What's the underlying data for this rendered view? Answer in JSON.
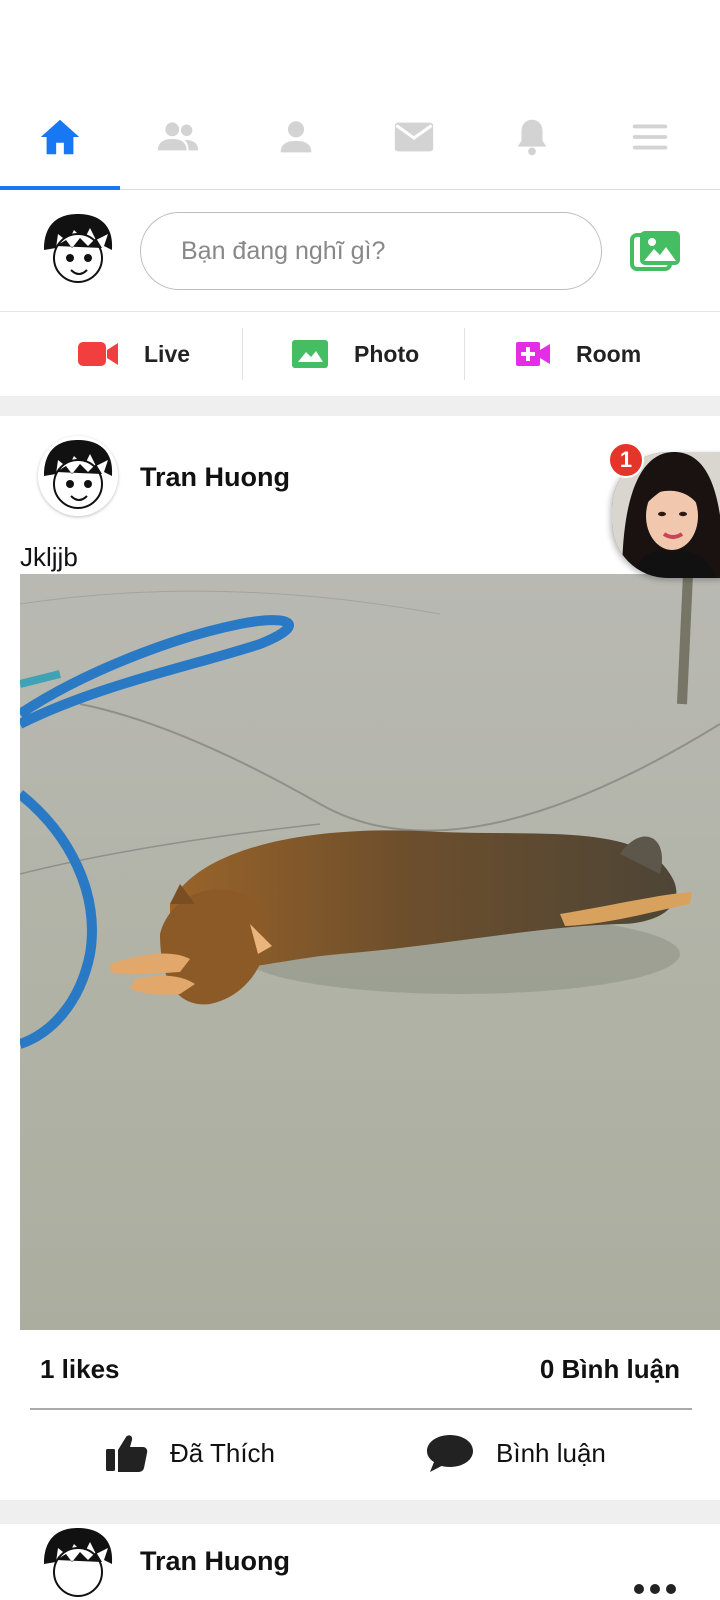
{
  "nav": {
    "tabs": [
      {
        "name": "home",
        "icon": "home-icon",
        "active": true
      },
      {
        "name": "friends",
        "icon": "friends-icon",
        "active": false
      },
      {
        "name": "profile",
        "icon": "profile-icon",
        "active": false
      },
      {
        "name": "messages",
        "icon": "mail-icon",
        "active": false
      },
      {
        "name": "notifications",
        "icon": "bell-icon",
        "active": false
      },
      {
        "name": "menu",
        "icon": "menu-icon",
        "active": false
      }
    ],
    "active_color": "#1877f2",
    "inactive_color": "#d3d3d3"
  },
  "composer": {
    "placeholder": "Bạn đang nghĩ gì?",
    "photo_icon": "photo-gallery-icon"
  },
  "quick_actions": [
    {
      "label": "Live",
      "icon": "video-camera-icon",
      "color": "#f23e3e"
    },
    {
      "label": "Photo",
      "icon": "photo-icon",
      "color": "#45bd62"
    },
    {
      "label": "Room",
      "icon": "video-add-icon",
      "color": "#e42ee6"
    }
  ],
  "post": {
    "author": "Tran Huong",
    "text": "Jkljjb",
    "image_icon": "dog-photo",
    "likes_text": "1 likes",
    "comments_text": "0 Bình luận",
    "like_button_label": "Đã Thích",
    "comment_button_label": "Bình luận"
  },
  "chat_head": {
    "badge_count": "1"
  },
  "next_post": {
    "author": "Tran Huong"
  }
}
